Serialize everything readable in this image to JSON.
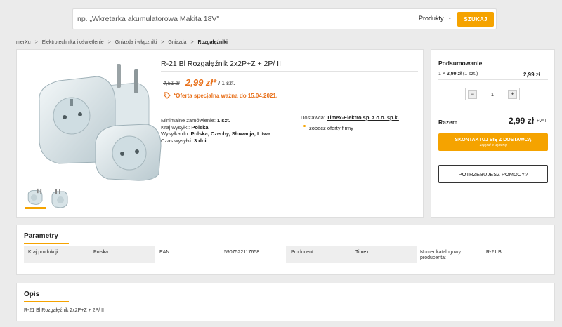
{
  "search": {
    "placeholder": "np. „Wkrętarka akumulatorowa Makita 18V\"",
    "scope": "Produkty",
    "button": "SZUKAJ"
  },
  "breadcrumb": [
    "merXu",
    "Elektrotechnika i oświetlenie",
    "Gniazda i włączniki",
    "Gniazda",
    "Rozgałęźniki"
  ],
  "product": {
    "title": "R-21 Bl Rozgałęźnik 2x2P+Z + 2P/ II",
    "old_price": "4,51 zł",
    "price": "2,99 zł*",
    "per_unit": "/ 1 szt.",
    "offer": "*Oferta specjalna ważna do 15.04.2021.",
    "min_order_label": "Minimalne zamówienie:",
    "min_order_value": "1 szt.",
    "ship_country_label": "Kraj wysyłki:",
    "ship_country_value": "Polska",
    "ship_to_label": "Wysyłka do:",
    "ship_to_value": "Polska, Czechy, Słowacja, Litwa",
    "ship_time_label": "Czas wysyłki:",
    "ship_time_value": "3 dni",
    "supplier_label": "Dostawca:",
    "supplier_value": "Timex-Elektro sp. z o.o. sp.k.",
    "firm_offers": "zobacz oferty firmy"
  },
  "summary": {
    "title": "Podsumowanie",
    "line_qty": "1 ×",
    "line_unit_price": "2,99 zł",
    "line_unit": "(1 szt.)",
    "line_total": "2,99 zł",
    "quantity": "1",
    "total_label": "Razem",
    "total_value": "2,99 zł",
    "vat": "+VAT",
    "contact_button": "SKONTAKTUJ SIĘ Z DOSTAWCĄ",
    "contact_sub": "zapytaj o wycenę",
    "help_button": "POTRZEBUJESZ POMOCY?"
  },
  "parameters": {
    "title": "Parametry",
    "items": [
      {
        "label": "Kraj produkcji:",
        "value": "Polska"
      },
      {
        "label": "EAN:",
        "value": "5907522117658"
      },
      {
        "label": "Producent:",
        "value": "Timex"
      },
      {
        "label": "Numer katalogowy producenta:",
        "value": "R-21 Bl"
      }
    ]
  },
  "description": {
    "title": "Opis",
    "text": "R-21 Bl Rozgałęźnik 2x2P+Z + 2P/ II"
  },
  "colors": {
    "accent": "#f5a300",
    "price": "#e8701a"
  }
}
